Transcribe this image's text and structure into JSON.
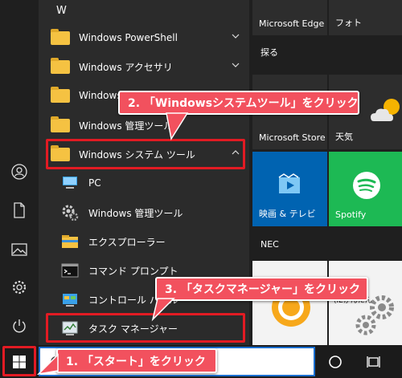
{
  "start_menu": {
    "section_letter": "W",
    "items": [
      {
        "label": "Windows PowerShell",
        "type": "folder",
        "expandable": true
      },
      {
        "label": "Windows アクセサリ",
        "type": "folder",
        "expandable": true
      },
      {
        "label": "Windows",
        "type": "folder",
        "expandable": false
      },
      {
        "label": "Windows 管理ツール",
        "type": "folder",
        "expandable": false
      },
      {
        "label": "Windows システム ツール",
        "type": "folder",
        "expanded": true
      }
    ],
    "subitems": [
      {
        "label": "PC",
        "icon": "pc-icon"
      },
      {
        "label": "Windows 管理ツール",
        "icon": "admin-tools-icon"
      },
      {
        "label": "エクスプローラー",
        "icon": "explorer-icon"
      },
      {
        "label": "コマンド プロンプト",
        "icon": "cmd-icon"
      },
      {
        "label": "コントロール パネル",
        "icon": "control-panel-icon"
      },
      {
        "label": "タスク マネージャー",
        "icon": "task-manager-icon"
      }
    ]
  },
  "tiles": {
    "top": [
      {
        "label": "Microsoft Edge"
      },
      {
        "label": "フォト"
      }
    ],
    "group1": "探る",
    "mid": [
      {
        "label": "Microsoft Store"
      },
      {
        "label": "天気"
      }
    ],
    "row3": [
      {
        "label": "映画 & テレビ"
      },
      {
        "label": "Spotify"
      }
    ],
    "group2": "NEC",
    "partial_text": "(IEかんたん"
  },
  "callouts": {
    "step1": "1. 「スタート」をクリック",
    "step2": "2. 「Windowsシステムツール」をクリック",
    "step3": "3. 「タスクマネージャー」をクリック"
  },
  "colors": {
    "highlight": "#e21b23",
    "callout_bg": "#f2515e",
    "folder": "#f5c242",
    "store_tile": "#0063b1",
    "spotify_tile": "#1db954"
  }
}
